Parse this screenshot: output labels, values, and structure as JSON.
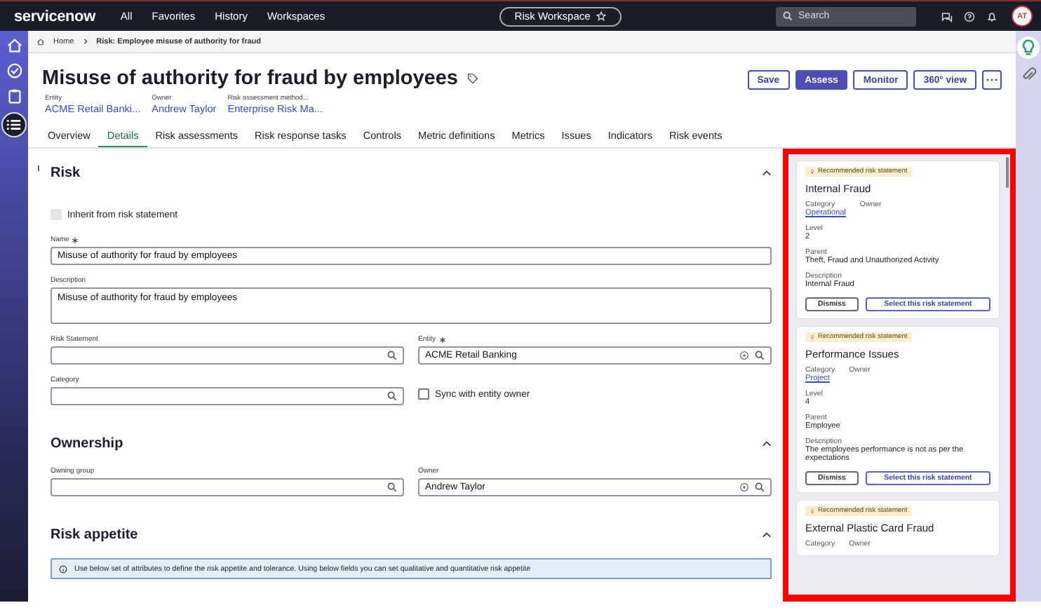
{
  "top_nav": {
    "logo": "servicenow",
    "menu": [
      "All",
      "Favorites",
      "History",
      "Workspaces"
    ],
    "workspace": "Risk Workspace",
    "search": {
      "placeholder": "Search"
    },
    "avatar": "AT"
  },
  "left_rail": [
    {
      "kind": "home",
      "selected": false
    },
    {
      "kind": "check",
      "selected": false
    },
    {
      "kind": "clipboard",
      "selected": false
    },
    {
      "kind": "list",
      "selected": true
    }
  ],
  "breadcrumb": [
    "Home",
    "Risk: Employee misuse of authority for fraud"
  ],
  "record": {
    "title": "Misuse of authority for fraud by employees",
    "meta": [
      {
        "label": "Entity",
        "value": "ACME Retail Banki..."
      },
      {
        "label": "Owner",
        "value": "Andrew Taylor"
      },
      {
        "label": "Risk assessment method...",
        "value": "Enterprise Risk Ma..."
      }
    ],
    "actions": [
      {
        "label": "Save",
        "kind": "secondary"
      },
      {
        "label": "Assess",
        "kind": "primary"
      },
      {
        "label": "Monitor",
        "kind": "secondary"
      },
      {
        "label": "360° view",
        "kind": "secondary"
      }
    ]
  },
  "tabs": [
    {
      "label": "Overview",
      "selected": false
    },
    {
      "label": "Details",
      "selected": true
    },
    {
      "label": "Risk assessments",
      "selected": false
    },
    {
      "label": "Risk response tasks",
      "selected": false
    },
    {
      "label": "Controls",
      "selected": false
    },
    {
      "label": "Metric definitions",
      "selected": false
    },
    {
      "label": "Metrics",
      "selected": false
    },
    {
      "label": "Issues",
      "selected": false
    },
    {
      "label": "Indicators",
      "selected": false
    },
    {
      "label": "Risk events",
      "selected": false
    }
  ],
  "sections": [
    {
      "title": "Risk",
      "expanded": true,
      "rows": [
        [
          {
            "kind": "checkbox",
            "label": "Inherit from risk statement",
            "checked": false,
            "disabled": true
          }
        ],
        [
          {
            "kind": "text",
            "label": "Name",
            "required": true,
            "value": "Misuse of authority for fraud by employees"
          }
        ],
        [
          {
            "kind": "textarea",
            "label": "Description",
            "value": "Misuse of authority for fraud by employees"
          }
        ],
        [
          {
            "kind": "reference",
            "label": "Risk Statement"
          },
          {
            "kind": "reference",
            "label": "Entity",
            "required": true,
            "value": "ACME Retail Banking",
            "preview": true
          }
        ],
        [
          {
            "kind": "reference",
            "label": "Category"
          },
          {
            "kind": "checkbox",
            "label": "Sync with entity owner",
            "checked": false,
            "disabled": false
          }
        ]
      ]
    },
    {
      "title": "Ownership",
      "expanded": true,
      "rows": [
        [
          {
            "kind": "reference",
            "label": "Owning group"
          },
          {
            "kind": "reference",
            "label": "Owner",
            "value": "Andrew Taylor",
            "preview": true
          }
        ]
      ]
    },
    {
      "title": "Risk appetite",
      "expanded": true,
      "note": "Use below set of attributes to define the risk appetite and tolerance. Using below fields you can set qualitative and quantitative risk appetite"
    }
  ],
  "recommendations": [
    {
      "badge": "Recommended risk statement",
      "title": "Internal Fraud",
      "category": {
        "label": "Category",
        "value": "Operational"
      },
      "owner": {
        "label": "Owner"
      },
      "details": [
        {
          "label": "Level",
          "value": "2"
        },
        {
          "label": "Parent",
          "value": "Theft, Fraud and Unauthorized Activity"
        },
        {
          "label": "Description",
          "value": "Internal Fraud"
        }
      ],
      "buttons": [
        "Dismiss",
        "Select this risk statement"
      ]
    },
    {
      "badge": "Recommended risk statement",
      "title": "Performance Issues",
      "category": {
        "label": "Category",
        "value": "Project"
      },
      "owner": {
        "label": "Owner"
      },
      "details": [
        {
          "label": "Level",
          "value": "4"
        },
        {
          "label": "Parent",
          "value": "Employee"
        },
        {
          "label": "Description",
          "value": "The employees performance is not as per the expectations"
        }
      ],
      "buttons": [
        "Dismiss",
        "Select this risk statement"
      ]
    },
    {
      "badge": "Recommended risk statement",
      "title": "External Plastic Card Fraud",
      "category": {
        "label": "Category"
      },
      "owner": {
        "label": "Owner"
      }
    }
  ],
  "right_rail": [
    {
      "kind": "bulb",
      "selected": true
    },
    {
      "kind": "clip",
      "selected": false
    }
  ]
}
